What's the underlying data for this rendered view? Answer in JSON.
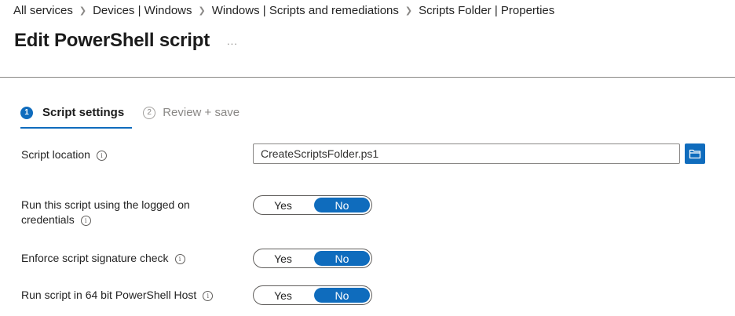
{
  "breadcrumb": {
    "items": [
      "All services",
      "Devices | Windows",
      "Windows | Scripts and remediations",
      "Scripts Folder | Properties"
    ],
    "separator": ">"
  },
  "page": {
    "title": "Edit PowerShell script",
    "more_label": "..."
  },
  "wizard": {
    "steps": [
      {
        "number": "1",
        "label": "Script settings",
        "state": "active"
      },
      {
        "number": "2",
        "label": "Review + save",
        "state": "inactive"
      }
    ]
  },
  "form": {
    "script_location": {
      "label": "Script location",
      "value": "CreateScriptsFolder.ps1",
      "browse_icon": "folder-open-icon"
    },
    "run_logged_on": {
      "label_line1": "Run this script using the logged on",
      "label_line2": "credentials",
      "yes_label": "Yes",
      "no_label": "No",
      "selected": "No"
    },
    "signature_check": {
      "label": "Enforce script signature check",
      "yes_label": "Yes",
      "no_label": "No",
      "selected": "No"
    },
    "run_64bit": {
      "label": "Run script in 64 bit PowerShell Host",
      "yes_label": "Yes",
      "no_label": "No",
      "selected": "No"
    },
    "info_icon_glyph": "i"
  },
  "colors": {
    "accent": "#0f6cbd",
    "divider": "#8a8886",
    "text": "#1b1b1b"
  }
}
